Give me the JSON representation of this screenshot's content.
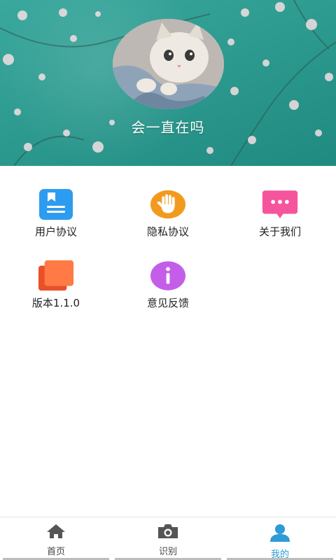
{
  "profile": {
    "nickname": "会一直在吗",
    "avatar_icon": "cat-avatar-icon"
  },
  "menu": [
    {
      "label": "用户协议",
      "icon": "document-icon",
      "color": "#2d9cf0"
    },
    {
      "label": "隐私协议",
      "icon": "hand-stop-icon",
      "color": "#f29a1f"
    },
    {
      "label": "关于我们",
      "icon": "chat-bubble-icon",
      "color": "#f5559c"
    },
    {
      "label": "版本1.1.0",
      "icon": "layers-icon",
      "color": "#f2643a"
    },
    {
      "label": "意见反馈",
      "icon": "info-icon",
      "color": "#c45ee8"
    }
  ],
  "tabs": [
    {
      "label": "首页",
      "icon": "home-icon",
      "active": false
    },
    {
      "label": "识别",
      "icon": "camera-icon",
      "active": false
    },
    {
      "label": "我的",
      "icon": "user-icon",
      "active": true
    }
  ],
  "colors": {
    "header_teal": "#2e9b90",
    "active_tab": "#2d9bd6"
  }
}
